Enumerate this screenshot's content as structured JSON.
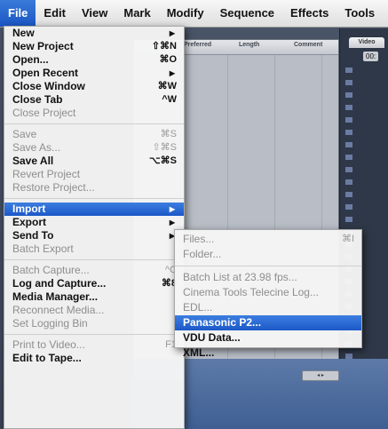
{
  "menubar": {
    "items": [
      "File",
      "Edit",
      "View",
      "Mark",
      "Modify",
      "Sequence",
      "Effects",
      "Tools"
    ],
    "active_index": 0
  },
  "background": {
    "browser_columns": [
      "Preferred",
      "Length",
      "Comment"
    ],
    "viewer_tab": "Video",
    "viewer_timecode": "00:"
  },
  "file_menu": {
    "groups": [
      [
        {
          "label": "New",
          "shortcut": "",
          "submenu": true,
          "enabled": true
        },
        {
          "label": "New Project",
          "shortcut": "⇧⌘N",
          "submenu": false,
          "enabled": true
        },
        {
          "label": "Open...",
          "shortcut": "⌘O",
          "submenu": false,
          "enabled": true
        },
        {
          "label": "Open Recent",
          "shortcut": "",
          "submenu": true,
          "enabled": true
        },
        {
          "label": "Close Window",
          "shortcut": "⌘W",
          "submenu": false,
          "enabled": true
        },
        {
          "label": "Close Tab",
          "shortcut": "^W",
          "submenu": false,
          "enabled": true
        },
        {
          "label": "Close Project",
          "shortcut": "",
          "submenu": false,
          "enabled": false
        }
      ],
      [
        {
          "label": "Save",
          "shortcut": "⌘S",
          "submenu": false,
          "enabled": false
        },
        {
          "label": "Save As...",
          "shortcut": "⇧⌘S",
          "submenu": false,
          "enabled": false
        },
        {
          "label": "Save All",
          "shortcut": "⌥⌘S",
          "submenu": false,
          "enabled": true
        },
        {
          "label": "Revert Project",
          "shortcut": "",
          "submenu": false,
          "enabled": false
        },
        {
          "label": "Restore Project...",
          "shortcut": "",
          "submenu": false,
          "enabled": false
        }
      ],
      [
        {
          "label": "Import",
          "shortcut": "",
          "submenu": true,
          "enabled": true,
          "highlight": true
        },
        {
          "label": "Export",
          "shortcut": "",
          "submenu": true,
          "enabled": true
        },
        {
          "label": "Send To",
          "shortcut": "",
          "submenu": true,
          "enabled": true
        },
        {
          "label": "Batch Export",
          "shortcut": "",
          "submenu": false,
          "enabled": false
        }
      ],
      [
        {
          "label": "Batch Capture...",
          "shortcut": "^C",
          "submenu": false,
          "enabled": false
        },
        {
          "label": "Log and Capture...",
          "shortcut": "⌘8",
          "submenu": false,
          "enabled": true
        },
        {
          "label": "Media Manager...",
          "shortcut": "",
          "submenu": false,
          "enabled": true
        },
        {
          "label": "Reconnect Media...",
          "shortcut": "",
          "submenu": false,
          "enabled": false
        },
        {
          "label": "Set Logging Bin",
          "shortcut": "",
          "submenu": false,
          "enabled": false
        }
      ],
      [
        {
          "label": "Print to Video...",
          "shortcut": "F1",
          "submenu": false,
          "enabled": false
        },
        {
          "label": "Edit to Tape...",
          "shortcut": "",
          "submenu": false,
          "enabled": true
        }
      ]
    ]
  },
  "import_submenu": {
    "groups": [
      [
        {
          "label": "Files...",
          "shortcut": "⌘I",
          "enabled": false
        },
        {
          "label": "Folder...",
          "shortcut": "",
          "enabled": false
        }
      ],
      [
        {
          "label": "Batch List at 23.98 fps...",
          "shortcut": "",
          "enabled": false
        },
        {
          "label": "Cinema Tools Telecine Log...",
          "shortcut": "",
          "enabled": false
        },
        {
          "label": "EDL...",
          "shortcut": "",
          "enabled": false
        },
        {
          "label": "Panasonic P2...",
          "shortcut": "",
          "enabled": true,
          "highlight": true
        },
        {
          "label": "VDU Data...",
          "shortcut": "",
          "enabled": true
        },
        {
          "label": "XML...",
          "shortcut": "",
          "enabled": true
        }
      ]
    ]
  },
  "icons": {
    "submenu_arrow": "▶"
  }
}
